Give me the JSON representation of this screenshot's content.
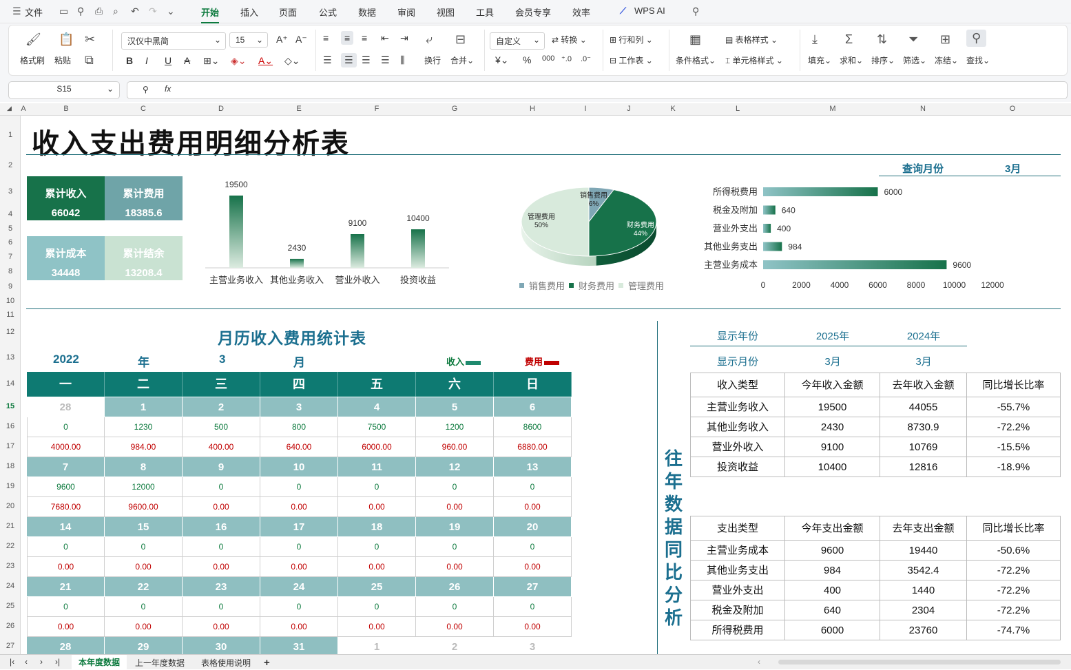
{
  "menubar": {
    "file_label": "文件",
    "tabs": [
      "开始",
      "插入",
      "页面",
      "公式",
      "数据",
      "审阅",
      "视图",
      "工具",
      "会员专享",
      "效率"
    ],
    "active_tab": "开始",
    "wps_ai": "WPS AI"
  },
  "ribbon": {
    "format_painter": "格式刷",
    "paste": "粘贴",
    "font_name": "汉仪中黑简",
    "font_size": "15",
    "wrap": "换行",
    "merge": "合并",
    "number_format": "自定义",
    "convert": "转换",
    "rows_cols": "行和列",
    "worksheet": "工作表",
    "cond_format": "条件格式",
    "table_style": "表格样式",
    "cell_style": "单元格样式",
    "fill": "填充",
    "sum": "求和",
    "sort": "排序",
    "filter": "筛选",
    "freeze": "冻结",
    "find": "查找"
  },
  "formula": {
    "cell_ref": "S15",
    "fx": "fx",
    "value": ""
  },
  "columns": [
    "A",
    "B",
    "C",
    "D",
    "E",
    "F",
    "G",
    "H",
    "I",
    "J",
    "K",
    "L",
    "M",
    "N",
    "O"
  ],
  "rows": [
    "1",
    "2",
    "3",
    "4",
    "5",
    "6",
    "7",
    "8",
    "9",
    "10",
    "11",
    "12",
    "13",
    "14",
    "15",
    "16",
    "17",
    "18",
    "19",
    "20",
    "21",
    "22",
    "23",
    "24",
    "25",
    "26",
    "27"
  ],
  "sheet": {
    "title": "收入支出费用明细分析表",
    "query_month_label": "查询月份",
    "query_month_value": "3月"
  },
  "kpis": [
    {
      "label": "累计收入",
      "value": "66042",
      "color": "#17724a"
    },
    {
      "label": "累计费用",
      "value": "18385.6",
      "color": "#6fa4a8"
    },
    {
      "label": "累计成本",
      "value": "34448",
      "color": "#8fc3c6"
    },
    {
      "label": "累计结余",
      "value": "13208.4",
      "color": "#c9e2d2"
    }
  ],
  "chart_data": [
    {
      "type": "bar",
      "categories": [
        "主营业务收入",
        "其他业务收入",
        "营业外收入",
        "投资收益"
      ],
      "values": [
        19500,
        2430,
        9100,
        10400
      ]
    },
    {
      "type": "pie",
      "labels": [
        "销售费用",
        "财务费用",
        "管理费用"
      ],
      "values": [
        6,
        44,
        50
      ],
      "value_labels": [
        "6%",
        "44%",
        "50%"
      ],
      "colors": [
        "#7fa7b5",
        "#17724a",
        "#d8eadc"
      ],
      "legend_position": "bottom"
    },
    {
      "type": "bar",
      "orientation": "horizontal",
      "categories": [
        "所得税费用",
        "税金及附加",
        "营业外支出",
        "其他业务支出",
        "主营业务成本"
      ],
      "values": [
        6000,
        640,
        400,
        984,
        9600
      ],
      "xticks": [
        "0",
        "2000",
        "4000",
        "6000",
        "8000",
        "10000",
        "12000"
      ],
      "xlim": [
        0,
        12000
      ]
    }
  ],
  "calendar": {
    "title": "月历收入费用统计表",
    "year": "2022",
    "year_unit": "年",
    "month": "3",
    "month_unit": "月",
    "legend_income": "收入",
    "legend_expense": "费用",
    "weekdays": [
      "一",
      "二",
      "三",
      "四",
      "五",
      "六",
      "日"
    ],
    "weeks": [
      {
        "days": [
          "28",
          "1",
          "2",
          "3",
          "4",
          "5",
          "6"
        ],
        "dim": [
          true,
          false,
          false,
          false,
          false,
          false,
          false
        ],
        "income": [
          "0",
          "1230",
          "500",
          "800",
          "7500",
          "1200",
          "8600"
        ],
        "expense": [
          "4000.00",
          "984.00",
          "400.00",
          "640.00",
          "6000.00",
          "960.00",
          "6880.00"
        ]
      },
      {
        "days": [
          "7",
          "8",
          "9",
          "10",
          "11",
          "12",
          "13"
        ],
        "dim": [
          false,
          false,
          false,
          false,
          false,
          false,
          false
        ],
        "income": [
          "9600",
          "12000",
          "0",
          "0",
          "0",
          "0",
          "0"
        ],
        "expense": [
          "7680.00",
          "9600.00",
          "0.00",
          "0.00",
          "0.00",
          "0.00",
          "0.00"
        ]
      },
      {
        "days": [
          "14",
          "15",
          "16",
          "17",
          "18",
          "19",
          "20"
        ],
        "dim": [
          false,
          false,
          false,
          false,
          false,
          false,
          false
        ],
        "income": [
          "0",
          "0",
          "0",
          "0",
          "0",
          "0",
          "0"
        ],
        "expense": [
          "0.00",
          "0.00",
          "0.00",
          "0.00",
          "0.00",
          "0.00",
          "0.00"
        ]
      },
      {
        "days": [
          "21",
          "22",
          "23",
          "24",
          "25",
          "26",
          "27"
        ],
        "dim": [
          false,
          false,
          false,
          false,
          false,
          false,
          false
        ],
        "income": [
          "0",
          "0",
          "0",
          "0",
          "0",
          "0",
          "0"
        ],
        "expense": [
          "0.00",
          "0.00",
          "0.00",
          "0.00",
          "0.00",
          "0.00",
          "0.00"
        ]
      },
      {
        "days": [
          "28",
          "29",
          "30",
          "31",
          "1",
          "2",
          "3"
        ],
        "dim": [
          false,
          false,
          false,
          false,
          true,
          true,
          true
        ],
        "income": [],
        "expense": []
      }
    ]
  },
  "comparison": {
    "side_title": "往年数据同比分析",
    "display_year_label": "显示年份",
    "year_current": "2025年",
    "year_previous": "2024年",
    "display_month_label": "显示月份",
    "month_current": "3月",
    "month_previous": "3月",
    "income_headers": [
      "收入类型",
      "今年收入金额",
      "去年收入金额",
      "同比增长比率"
    ],
    "income_rows": [
      [
        "主营业务收入",
        "19500",
        "44055",
        "-55.7%"
      ],
      [
        "其他业务收入",
        "2430",
        "8730.9",
        "-72.2%"
      ],
      [
        "营业外收入",
        "9100",
        "10769",
        "-15.5%"
      ],
      [
        "投资收益",
        "10400",
        "12816",
        "-18.9%"
      ]
    ],
    "expense_headers": [
      "支出类型",
      "今年支出金额",
      "去年支出金额",
      "同比增长比率"
    ],
    "expense_rows": [
      [
        "主营业务成本",
        "9600",
        "19440",
        "-50.6%"
      ],
      [
        "其他业务支出",
        "984",
        "3542.4",
        "-72.2%"
      ],
      [
        "营业外支出",
        "400",
        "1440",
        "-72.2%"
      ],
      [
        "税金及附加",
        "640",
        "2304",
        "-72.2%"
      ],
      [
        "所得税费用",
        "6000",
        "23760",
        "-74.7%"
      ]
    ]
  },
  "sheet_tabs": [
    "本年度数据",
    "上一年度数据",
    "表格使用说明"
  ],
  "active_sheet": "本年度数据"
}
